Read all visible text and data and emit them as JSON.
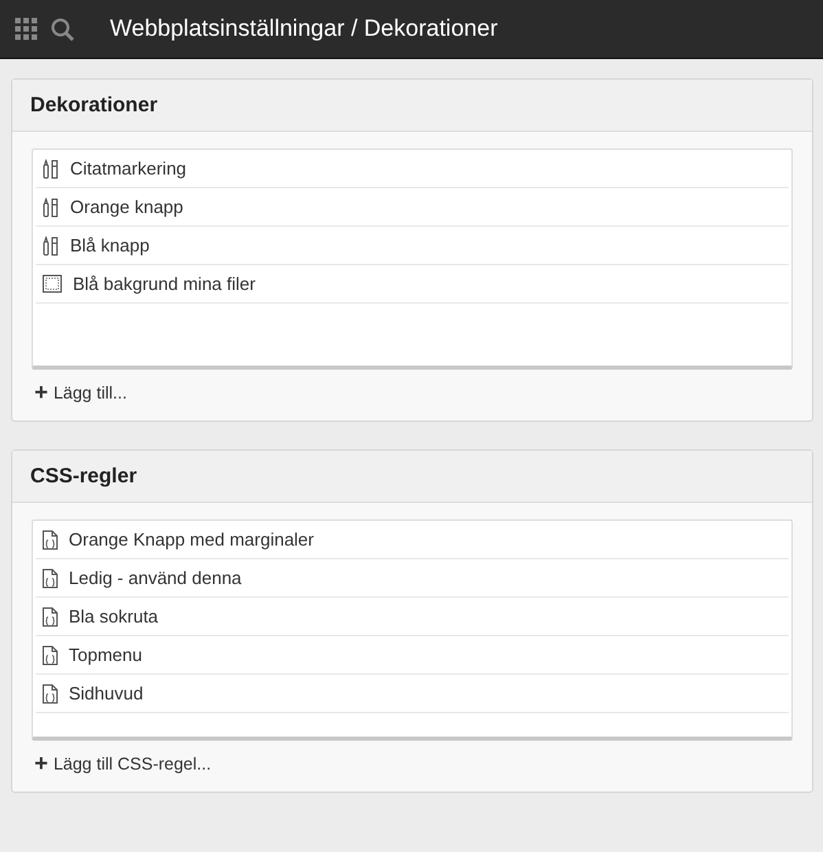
{
  "topbar": {
    "title": "Webbplatsinställningar / Dekorationer"
  },
  "panels": [
    {
      "title": "Dekorationer",
      "items": [
        {
          "label": "Citatmarkering",
          "kind": "style"
        },
        {
          "label": "Orange knapp",
          "kind": "style"
        },
        {
          "label": "Blå knapp",
          "kind": "style"
        },
        {
          "label": "Blå bakgrund mina filer",
          "kind": "block"
        }
      ],
      "add": {
        "icon": "+",
        "label": "Lägg till..."
      }
    },
    {
      "title": "CSS-regler",
      "items": [
        {
          "label": "Orange Knapp med marginaler",
          "kind": "css"
        },
        {
          "label": "Ledig - använd denna",
          "kind": "css"
        },
        {
          "label": "Bla sokruta",
          "kind": "css"
        },
        {
          "label": "Topmenu",
          "kind": "css"
        },
        {
          "label": "Sidhuvud",
          "kind": "css"
        }
      ],
      "add": {
        "icon": "+",
        "label": "Lägg till CSS-regel..."
      }
    }
  ]
}
